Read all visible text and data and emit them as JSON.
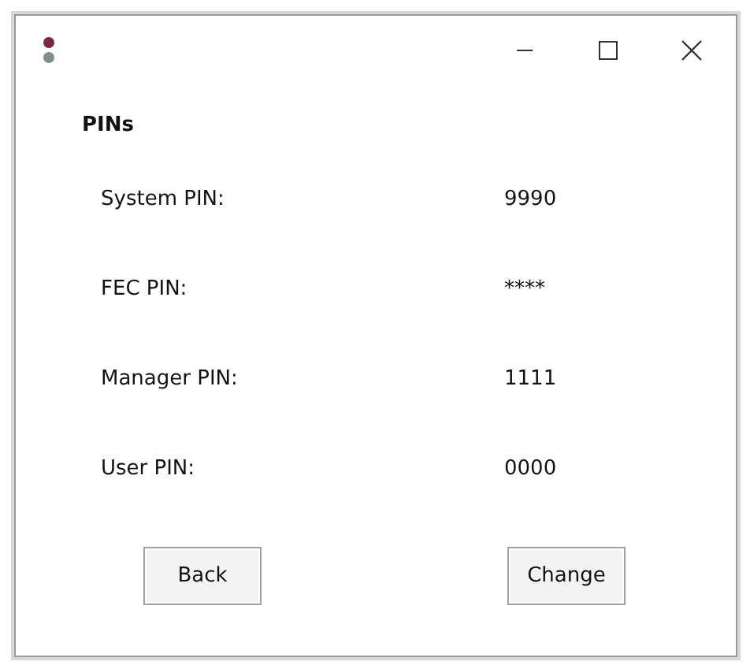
{
  "heading": "PINs",
  "pins": [
    {
      "label": "System PIN:",
      "value": "9990"
    },
    {
      "label": "FEC PIN:",
      "value": "****"
    },
    {
      "label": "Manager PIN:",
      "value": "1111"
    },
    {
      "label": "User PIN:",
      "value": "0000"
    }
  ],
  "buttons": [
    "Back",
    "Change"
  ]
}
